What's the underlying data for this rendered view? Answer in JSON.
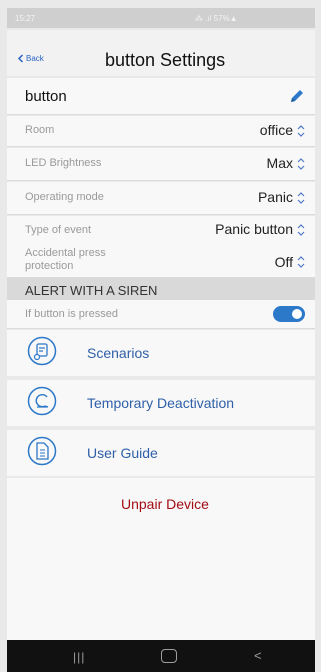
{
  "statusbar": {
    "time": "15:27",
    "indicators": "⁂ .ıl 57%▲"
  },
  "header": {
    "back_label": "Back",
    "title": "button Settings"
  },
  "device": {
    "name": "button"
  },
  "rows": [
    {
      "label": "Room",
      "value": "office"
    },
    {
      "label": "LED Brightness",
      "value": "Max"
    },
    {
      "label": "Operating mode",
      "value": "Panic"
    },
    {
      "label": "Type of event",
      "value": "Panic button"
    },
    {
      "label": "Accidental press protection",
      "value": "Off"
    }
  ],
  "section": {
    "title": "ALERT WITH A SIREN"
  },
  "siren_toggle": {
    "label": "If button is pressed",
    "enabled": true
  },
  "menu": [
    {
      "label": "Scenarios",
      "icon": "scenarios-icon"
    },
    {
      "label": "Temporary Deactivation",
      "icon": "deactivation-icon"
    },
    {
      "label": "User Guide",
      "icon": "guide-icon"
    }
  ],
  "unpair_label": "Unpair Device",
  "colors": {
    "accent": "#2c78c9",
    "link": "#2e5fa8",
    "danger": "#a10d13",
    "section_bg": "#d9d9d9"
  },
  "nav": {
    "recent": "|||",
    "home": "○",
    "back": "<"
  }
}
